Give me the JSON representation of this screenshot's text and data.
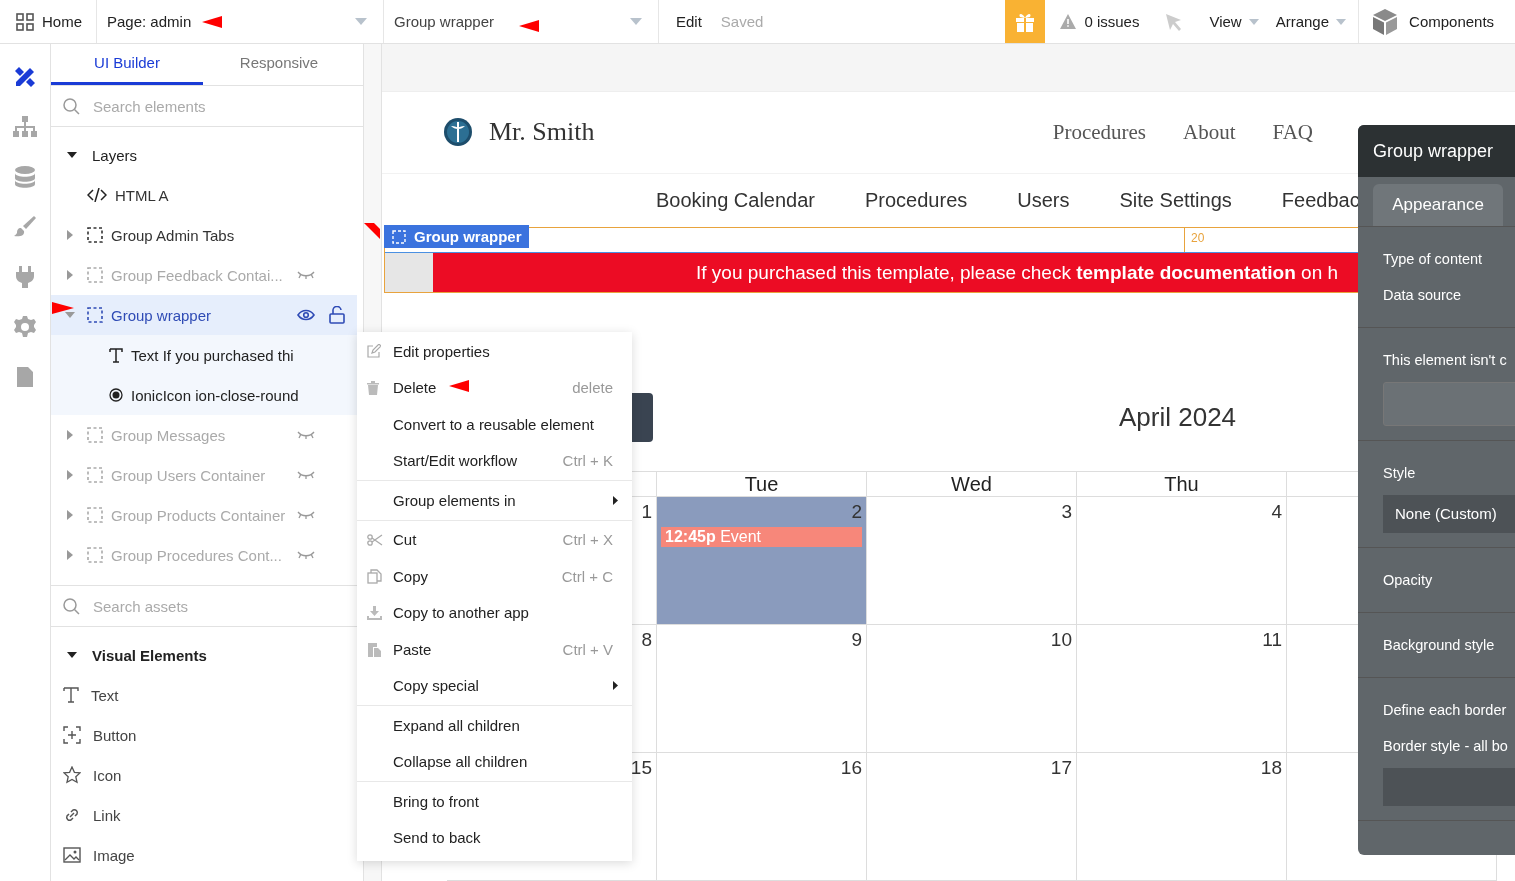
{
  "topbar": {
    "home": "Home",
    "page_selector": "Page: admin",
    "element_selector": "Group wrapper",
    "edit": "Edit",
    "save_status": "Saved",
    "issues": "0 issues",
    "menus": [
      "View",
      "Arrange"
    ],
    "components": "Components"
  },
  "rail": [
    {
      "kind": "design",
      "selected": true
    },
    {
      "kind": "workflow",
      "selected": false
    },
    {
      "kind": "data",
      "selected": false
    },
    {
      "kind": "styles",
      "selected": false
    },
    {
      "kind": "plugins",
      "selected": false
    },
    {
      "kind": "settings",
      "selected": false
    },
    {
      "kind": "logs",
      "selected": false
    }
  ],
  "sidebar": {
    "tabs": [
      {
        "label": "UI Builder",
        "selected": true
      },
      {
        "label": "Responsive",
        "selected": false
      }
    ],
    "element_search": {
      "placeholder": "Search elements"
    },
    "layers": {
      "title": "Layers",
      "expanded": true,
      "items": [
        {
          "kind": "html",
          "label": "HTML A",
          "hidden": false,
          "selected": false
        },
        {
          "kind": "group",
          "label": "Group Admin Tabs",
          "expanded": false,
          "hidden": false,
          "selected": false
        },
        {
          "kind": "group",
          "label": "Group Feedback Contai...",
          "expanded": false,
          "hidden": true,
          "selected": false
        },
        {
          "kind": "group",
          "label": "Group wrapper",
          "expanded": true,
          "hidden": false,
          "selected": true,
          "children": [
            {
              "kind": "text",
              "label": "Text If you purchased thi"
            },
            {
              "kind": "icon",
              "label": "IonicIcon ion-close-round"
            }
          ]
        },
        {
          "kind": "group",
          "label": "Group Messages",
          "expanded": false,
          "hidden": true,
          "selected": false
        },
        {
          "kind": "group",
          "label": "Group Users Container",
          "expanded": false,
          "hidden": true,
          "selected": false
        },
        {
          "kind": "group",
          "label": "Group Products Container",
          "expanded": false,
          "hidden": true,
          "selected": false
        },
        {
          "kind": "group",
          "label": "Group Procedures Cont...",
          "expanded": false,
          "hidden": true,
          "selected": false
        }
      ]
    },
    "asset_search": {
      "placeholder": "Search assets"
    },
    "visual_elements": {
      "title": "Visual Elements",
      "expanded": true,
      "items": [
        {
          "kind": "text",
          "label": "Text"
        },
        {
          "kind": "button",
          "label": "Button"
        },
        {
          "kind": "icon",
          "label": "Icon"
        },
        {
          "kind": "link",
          "label": "Link"
        },
        {
          "kind": "image",
          "label": "Image"
        }
      ]
    }
  },
  "canvas": {
    "site_header": {
      "brand": "Mr. Smith",
      "nav": [
        "Procedures",
        "About",
        "FAQ"
      ]
    },
    "admin_tabs": [
      "Booking Calendar",
      "Procedures",
      "Users",
      "Site Settings",
      "Feedbac"
    ],
    "selection_label": "Group wrapper",
    "spacing_label": "20",
    "banner": "If you purchased this template, please check **template documentation** on h",
    "calendar": {
      "title": "April 2024",
      "columns": [
        "",
        "Tue",
        "Wed",
        "Thu",
        ""
      ],
      "weeks": [
        {
          "days": [
            {
              "day": "1",
              "selected": false
            },
            {
              "day": "2",
              "selected": true,
              "events": [
                {
                  "time": "12:45p",
                  "title": "Event"
                }
              ]
            },
            {
              "day": "3",
              "selected": false
            },
            {
              "day": "4",
              "selected": false
            }
          ]
        },
        {
          "days": [
            {
              "day": "8",
              "selected": false
            },
            {
              "day": "9",
              "selected": false
            },
            {
              "day": "10",
              "selected": false
            },
            {
              "day": "11",
              "selected": false
            }
          ]
        },
        {
          "days": [
            {
              "day": "15",
              "selected": false
            },
            {
              "day": "16",
              "selected": false
            },
            {
              "day": "17",
              "selected": false
            },
            {
              "day": "18",
              "selected": false
            }
          ]
        }
      ]
    }
  },
  "context_menu": {
    "groups": [
      {
        "items": [
          {
            "kind": "edit",
            "label": "Edit properties",
            "submenu": false
          },
          {
            "kind": "delete",
            "label": "Delete",
            "shortcut": "delete",
            "submenu": false
          },
          {
            "kind": "convert",
            "label": "Convert to a reusable element",
            "submenu": false
          },
          {
            "kind": "workflow",
            "label": "Start/Edit workflow",
            "shortcut": "Ctrl + K",
            "submenu": false
          }
        ]
      },
      {
        "items": [
          {
            "kind": "group",
            "label": "Group elements in",
            "submenu": true
          }
        ]
      },
      {
        "items": [
          {
            "kind": "cut",
            "label": "Cut",
            "shortcut": "Ctrl + X",
            "submenu": false
          },
          {
            "kind": "copy",
            "label": "Copy",
            "shortcut": "Ctrl + C",
            "submenu": false
          },
          {
            "kind": "export",
            "label": "Copy to another app",
            "submenu": false
          },
          {
            "kind": "paste",
            "label": "Paste",
            "shortcut": "Ctrl + V",
            "submenu": false
          },
          {
            "kind": "special",
            "label": "Copy special",
            "submenu": true
          }
        ]
      },
      {
        "items": [
          {
            "kind": "expand",
            "label": "Expand all children",
            "submenu": false
          },
          {
            "kind": "collapse",
            "label": "Collapse all children",
            "submenu": false
          }
        ]
      },
      {
        "items": [
          {
            "kind": "front",
            "label": "Bring to front",
            "submenu": false
          },
          {
            "kind": "back",
            "label": "Send to back",
            "submenu": false
          }
        ]
      }
    ]
  },
  "properties_panel": {
    "title": "Group wrapper",
    "tabs": [
      {
        "label": "Appearance",
        "selected": true
      }
    ],
    "sections": [
      {
        "rows": [
          {
            "kind": "label",
            "text": "Type of content"
          },
          {
            "kind": "label",
            "text": "Data source"
          }
        ]
      },
      {
        "rows": [
          {
            "kind": "label",
            "text": "This element isn't c"
          },
          {
            "kind": "input"
          }
        ]
      },
      {
        "rows": [
          {
            "kind": "label",
            "text": "Style"
          },
          {
            "kind": "dropdown",
            "value": "None (Custom)"
          }
        ]
      },
      {
        "rows": [
          {
            "kind": "label",
            "text": "Opacity"
          }
        ]
      },
      {
        "rows": [
          {
            "kind": "label",
            "text": "Background style"
          }
        ]
      },
      {
        "rows": [
          {
            "kind": "label",
            "text": "Define each border"
          },
          {
            "kind": "label",
            "text": "Border style - all bo"
          },
          {
            "kind": "dropdown"
          }
        ]
      }
    ]
  }
}
